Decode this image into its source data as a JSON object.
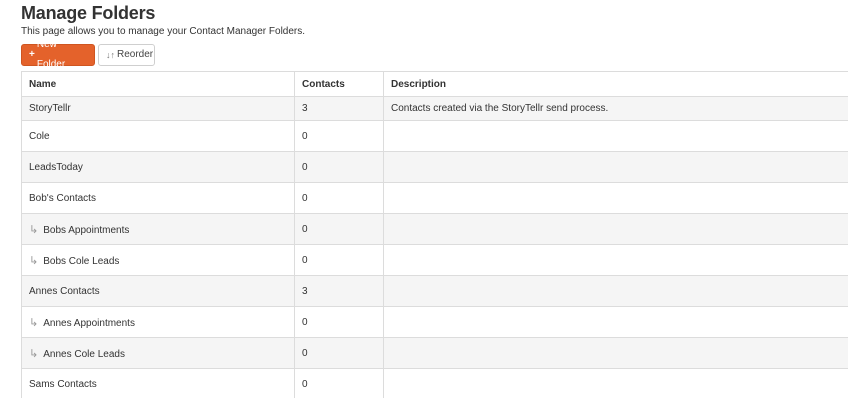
{
  "page": {
    "title": "Manage Folders",
    "subtitle": "This page allows you to manage your Contact Manager Folders."
  },
  "toolbar": {
    "new_folder_icon": "plus-icon",
    "new_folder_label": "New Folder",
    "reorder_icon": "sort-arrows-icon",
    "reorder_label": "Reorder",
    "accent_color": "#e4622b"
  },
  "table": {
    "columns": [
      "Name",
      "Contacts",
      "Description"
    ],
    "rows": [
      {
        "name": "StoryTellr",
        "contacts": "3",
        "description": "Contacts created via the StoryTellr send process.",
        "child": false
      },
      {
        "name": "Cole",
        "contacts": "0",
        "description": "",
        "child": false
      },
      {
        "name": "LeadsToday",
        "contacts": "0",
        "description": "",
        "child": false
      },
      {
        "name": "Bob's Contacts",
        "contacts": "0",
        "description": "",
        "child": false
      },
      {
        "name": "Bobs Appointments",
        "contacts": "0",
        "description": "",
        "child": true
      },
      {
        "name": "Bobs Cole Leads",
        "contacts": "0",
        "description": "",
        "child": true
      },
      {
        "name": "Annes Contacts",
        "contacts": "3",
        "description": "",
        "child": false
      },
      {
        "name": "Annes Appointments",
        "contacts": "0",
        "description": "",
        "child": true
      },
      {
        "name": "Annes Cole Leads",
        "contacts": "0",
        "description": "",
        "child": true
      },
      {
        "name": "Sams Contacts",
        "contacts": "0",
        "description": "",
        "child": false
      }
    ]
  }
}
